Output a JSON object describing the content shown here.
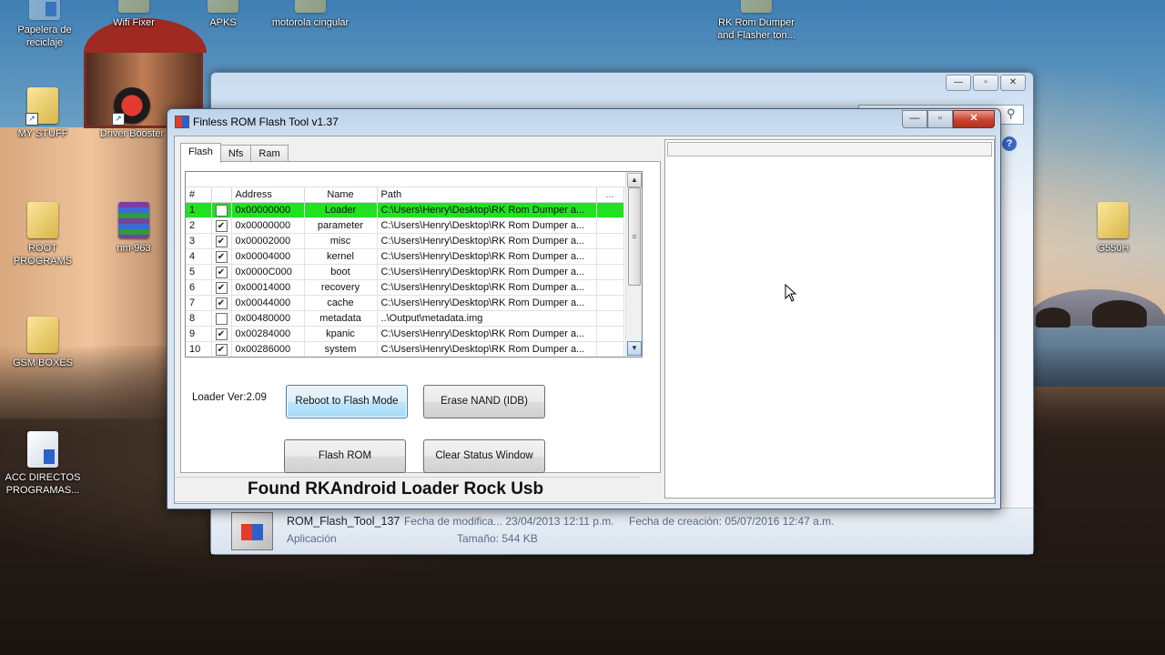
{
  "desktop": {
    "icons": [
      {
        "label": "Papelera de reciclaje",
        "glyph": "recycle-bin-icon"
      },
      {
        "label": "Wifi Fixer",
        "glyph": "folder-icon"
      },
      {
        "label": "APKS",
        "glyph": "folder-icon"
      },
      {
        "label": "motorola cingular",
        "glyph": "folder-icon"
      },
      {
        "label": "RK Rom Dumper and Flasher ton...",
        "glyph": "folder-icon"
      },
      {
        "label": "MY STUFF",
        "glyph": "folder-icon"
      },
      {
        "label": "Driver Booster",
        "glyph": "app-icon"
      },
      {
        "label": "ROOT PROGRAMS",
        "glyph": "folder-icon"
      },
      {
        "label": "nm-963",
        "glyph": "rar-icon"
      },
      {
        "label": "G550H",
        "glyph": "folder-icon"
      },
      {
        "label": "GSM BOXES",
        "glyph": "folder-icon"
      },
      {
        "label": "ACC DIRECTOS PROGRAMAS...",
        "glyph": "document-icon"
      }
    ]
  },
  "explorer": {
    "details": {
      "filename": "ROM_Flash_Tool_137",
      "type": "Aplicación",
      "modified": "Fecha de modifica... 23/04/2013 12:11 p.m.",
      "created": "Fecha de creación: 05/07/2016 12:47 a.m.",
      "size": "Tamaño: 544 KB"
    }
  },
  "tool": {
    "title": "Finless ROM Flash Tool v1.37",
    "tabs": [
      "Flash",
      "Nfs",
      "Ram"
    ],
    "columns": [
      "#",
      "",
      "Address",
      "Name",
      "Path",
      "..."
    ],
    "rows": [
      {
        "num": "1",
        "checked": false,
        "address": "0x00000000",
        "name": "Loader",
        "path": "C:\\Users\\Henry\\Desktop\\RK Rom Dumper a...",
        "highlight": true
      },
      {
        "num": "2",
        "checked": true,
        "address": "0x00000000",
        "name": "parameter",
        "path": "C:\\Users\\Henry\\Desktop\\RK Rom Dumper a..."
      },
      {
        "num": "3",
        "checked": true,
        "address": "0x00002000",
        "name": "misc",
        "path": "C:\\Users\\Henry\\Desktop\\RK Rom Dumper a..."
      },
      {
        "num": "4",
        "checked": true,
        "address": "0x00004000",
        "name": "kernel",
        "path": "C:\\Users\\Henry\\Desktop\\RK Rom Dumper a..."
      },
      {
        "num": "5",
        "checked": true,
        "address": "0x0000C000",
        "name": "boot",
        "path": "C:\\Users\\Henry\\Desktop\\RK Rom Dumper a..."
      },
      {
        "num": "6",
        "checked": true,
        "address": "0x00014000",
        "name": "recovery",
        "path": "C:\\Users\\Henry\\Desktop\\RK Rom Dumper a..."
      },
      {
        "num": "7",
        "checked": true,
        "address": "0x00044000",
        "name": "cache",
        "path": "C:\\Users\\Henry\\Desktop\\RK Rom Dumper a..."
      },
      {
        "num": "8",
        "checked": false,
        "address": "0x00480000",
        "name": "metadata",
        "path": "..\\Output\\metadata.img"
      },
      {
        "num": "9",
        "checked": true,
        "address": "0x00284000",
        "name": "kpanic",
        "path": "C:\\Users\\Henry\\Desktop\\RK Rom Dumper a..."
      },
      {
        "num": "10",
        "checked": true,
        "address": "0x00286000",
        "name": "system",
        "path": "C:\\Users\\Henry\\Desktop\\RK Rom Dumper a..."
      }
    ],
    "loader_version": "Loader Ver:2.09",
    "buttons": {
      "reboot": "Reboot to Flash Mode",
      "erase": "Erase NAND (IDB)",
      "flash": "Flash ROM",
      "clear": "Clear Status Window"
    },
    "status": "Found RKAndroid Loader Rock Usb",
    "colors": {
      "highlight_row": "#21e121",
      "close_button": "#c6432f"
    }
  }
}
